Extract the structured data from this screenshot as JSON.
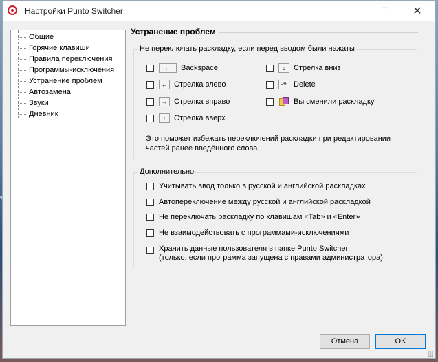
{
  "window": {
    "title": "Настройки Punto Switcher",
    "minimize": "—",
    "maximize": "☐",
    "close": "✕"
  },
  "nav": {
    "items": [
      {
        "label": "Общие"
      },
      {
        "label": "Горячие клавиши"
      },
      {
        "label": "Правила переключения"
      },
      {
        "label": "Программы-исключения"
      },
      {
        "label": "Устранение проблем",
        "selected": true
      },
      {
        "label": "Автозамена"
      },
      {
        "label": "Звуки"
      },
      {
        "label": "Дневник"
      }
    ]
  },
  "section": {
    "title": "Устранение проблем"
  },
  "keys_group": {
    "label": "Не переключать раскладку, если перед вводом были нажаты",
    "left": [
      {
        "key": "←",
        "label": "Backspace",
        "checked": false
      },
      {
        "key": "←",
        "label": "Стрелка влево",
        "checked": false
      },
      {
        "key": "→",
        "label": "Стрелка вправо",
        "checked": false
      },
      {
        "key": "↑",
        "label": "Стрелка вверх",
        "checked": false
      }
    ],
    "right": [
      {
        "key": "↓",
        "label": "Стрелка вниз",
        "checked": false
      },
      {
        "key": "Del",
        "label": "Delete",
        "checked": false
      },
      {
        "icon": "layout-swap-icon",
        "label": "Вы сменили раскладку",
        "checked": false
      }
    ],
    "note": "Это поможет избежать переключений раскладки при редактировании частей ранее введённого слова."
  },
  "extra_group": {
    "label": "Дополнительно",
    "options": [
      {
        "label": "Учитывать ввод только в русской и английской раскладках",
        "checked": false
      },
      {
        "label": "Автопереключение между русской и английской раскладкой",
        "checked": false
      },
      {
        "label": "Не переключать раскладку по клавишам «Tab» и «Enter»",
        "checked": false
      },
      {
        "label": "Не взаимодействовать с программами-исключениями",
        "checked": false
      },
      {
        "label1": "Хранить данные пользователя в папке Punto Switcher",
        "label2": "(только, если программа запущена с правами администратора)",
        "checked": false
      }
    ]
  },
  "buttons": {
    "cancel": "Отмена",
    "ok": "OK"
  },
  "desktop": {
    "edge_text": "ws"
  }
}
